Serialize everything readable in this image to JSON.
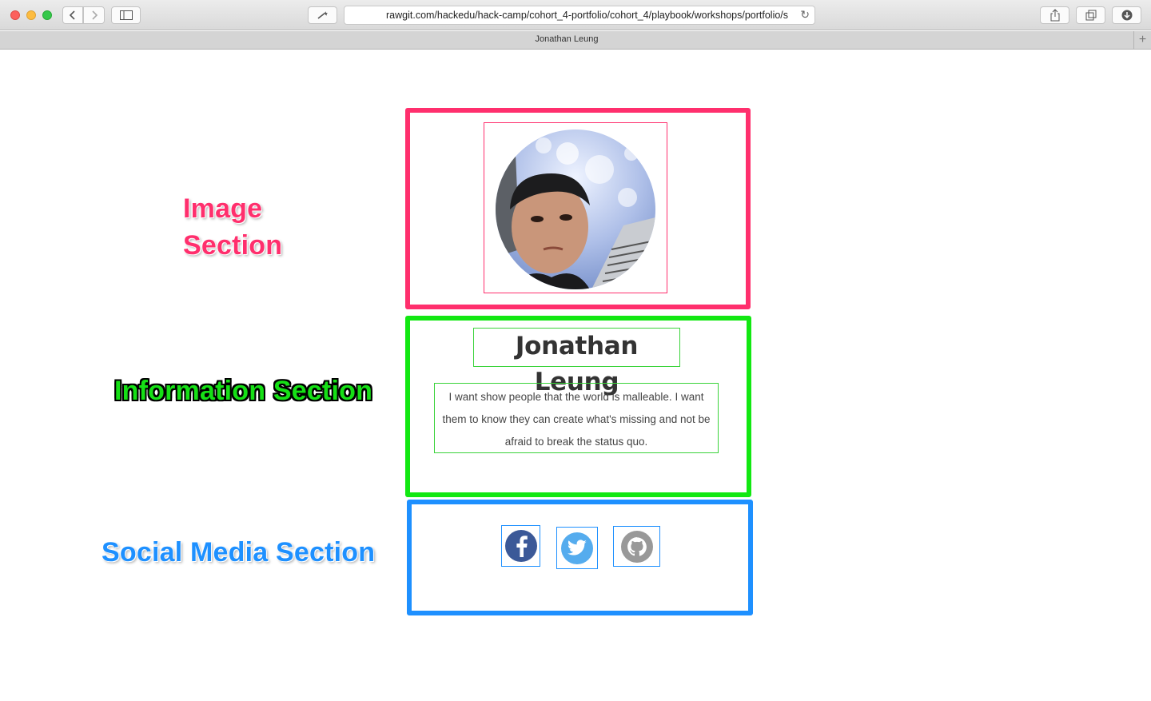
{
  "browser": {
    "url": "rawgit.com/hackedu/hack-camp/cohort_4-portfolio/cohort_4/playbook/workshops/portfolio/s",
    "tab_title": "Jonathan Leung"
  },
  "annotations": {
    "image_line1": "Image",
    "image_line2": "Section",
    "information": "Information Section",
    "social": "Social Media Section"
  },
  "profile": {
    "name": "Jonathan Leung",
    "bio": "I want show people that the world is malleable. I want them to know they can create what's missing and not be afraid to break the status quo."
  },
  "social_icons": [
    "facebook-icon",
    "twitter-icon",
    "github-icon"
  ],
  "colors": {
    "image_section": "#ff2f6d",
    "information_section": "#12e812",
    "social_section": "#1e90ff",
    "facebook": "#3b5998",
    "twitter": "#55acee",
    "github": "#999999"
  }
}
